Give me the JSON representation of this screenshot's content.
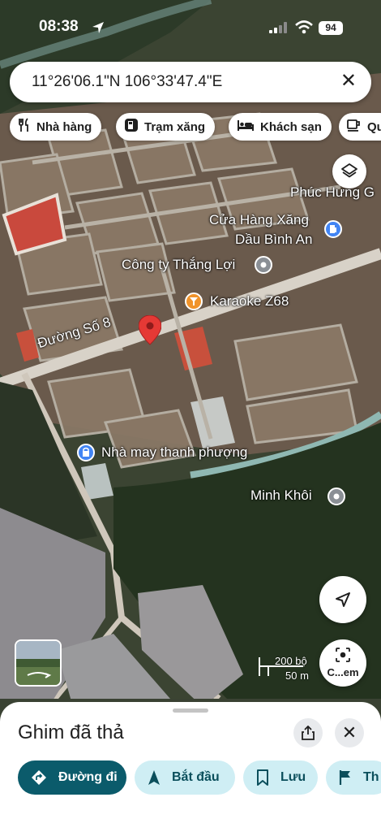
{
  "status_bar": {
    "time": "08:38",
    "battery": "94"
  },
  "search": {
    "query": "11°26'06.1\"N 106°33'47.4\"E",
    "close_icon": "close-icon"
  },
  "chips": [
    {
      "label": "Nhà hàng",
      "icon": "restaurant-icon"
    },
    {
      "label": "Trạm xăng",
      "icon": "gas-station-icon"
    },
    {
      "label": "Khách sạn",
      "icon": "hotel-icon"
    },
    {
      "label": "Qu",
      "icon": "coffee-icon"
    }
  ],
  "map_labels": {
    "phuc_hung": "Phúc Hưng G",
    "cua_hang_xang_line1": "Cửa Hàng Xăng",
    "cua_hang_xang_line2": "Dầu Bình An",
    "cong_ty": "Công ty Thắng Lợi",
    "karaoke": "Karaoke Z68",
    "road": "Đường Số 8",
    "nha_may": "Nhà may thanh phượng",
    "minh_khoi": "Minh Khôi"
  },
  "scale": {
    "imperial": "200 bộ",
    "metric": "50 m"
  },
  "lens_label": "C...em",
  "sheet": {
    "title": "Ghim đã thả",
    "actions": [
      {
        "label": "Đường đi",
        "icon": "directions-icon"
      },
      {
        "label": "Bắt đầu",
        "icon": "navigation-arrow-icon"
      },
      {
        "label": "Lưu",
        "icon": "bookmark-icon"
      },
      {
        "label": "Th",
        "icon": "flag-icon"
      }
    ]
  },
  "colors": {
    "primary": "#0b5b6b",
    "secondary": "#cfeef4",
    "pin": "#e53935",
    "poi_blue": "#4285f4",
    "poi_orange": "#f0932b",
    "poi_gray": "#8a8f95"
  }
}
